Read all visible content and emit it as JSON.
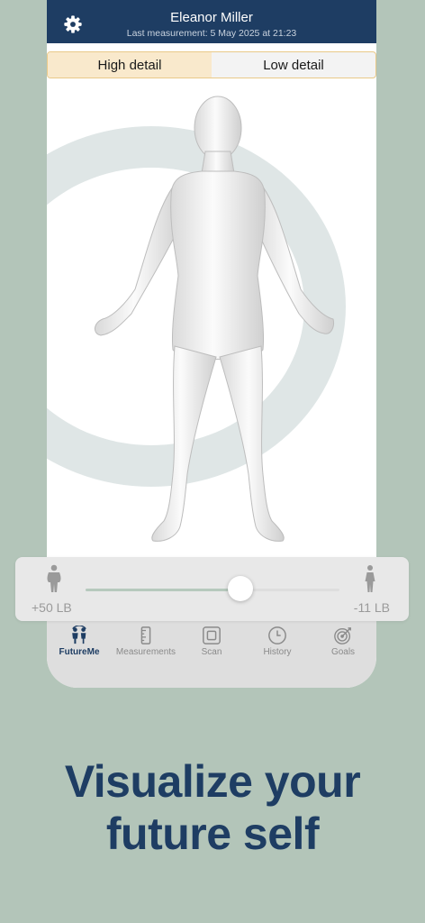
{
  "header": {
    "user_name": "Eleanor Miller",
    "last_measurement": "Last measurement: 5 May 2025 at 21:23",
    "settings_icon": "gear-icon"
  },
  "view_toggle": {
    "options": [
      "High detail",
      "Low detail"
    ],
    "selected": "High detail"
  },
  "slider": {
    "left_label": "+50 LB",
    "right_label": "-11 LB",
    "left_icon": "heavier-person-icon",
    "right_icon": "slimmer-person-icon",
    "value_fraction": 0.61
  },
  "tabs": [
    {
      "label": "FutureMe",
      "icon": "futureme-icon",
      "active": true
    },
    {
      "label": "Measurements",
      "icon": "ruler-icon",
      "active": false
    },
    {
      "label": "Scan",
      "icon": "scan-icon",
      "active": false
    },
    {
      "label": "History",
      "icon": "clock-icon",
      "active": false
    },
    {
      "label": "Goals",
      "icon": "target-icon",
      "active": false
    }
  ],
  "headline": [
    "Visualize your",
    "future self"
  ],
  "colors": {
    "background": "#b3c5b9",
    "header": "#1e3d63",
    "accent": "#1e3d63",
    "segment_active": "#f9e9cc",
    "ring": "#dfe6e6"
  }
}
